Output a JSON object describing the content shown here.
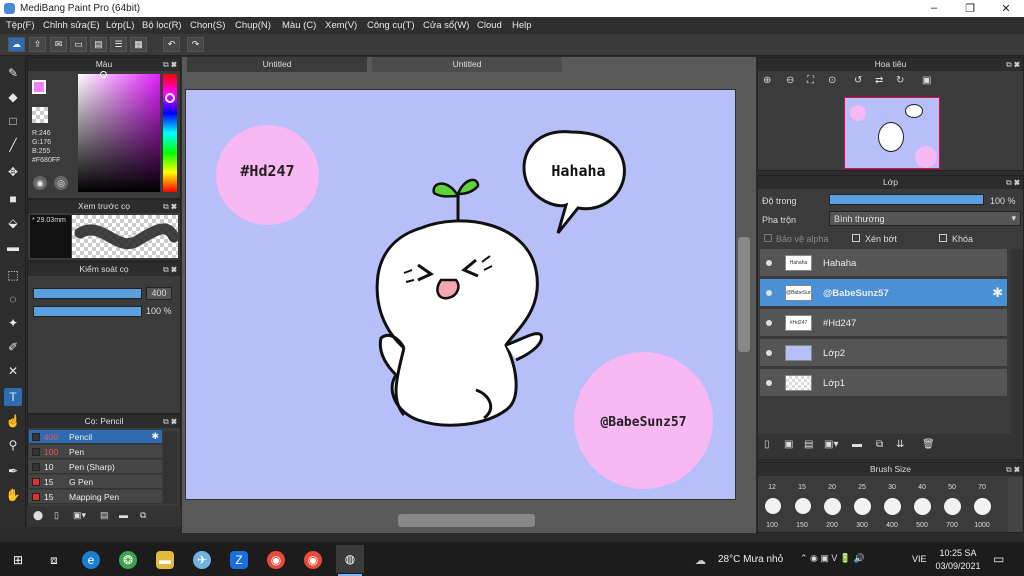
{
  "window": {
    "title": "MediBang Paint Pro (64bit)",
    "minimize": "–",
    "maximize": "❐",
    "close": "✕"
  },
  "menu": [
    "Tệp(F)",
    "Chỉnh sửa(E)",
    "Lớp(L)",
    "Bộ lọc(R)",
    "Chọn(S)",
    "Chụp(N)",
    "Màu (C)",
    "Xem(V)",
    "Công cụ(T)",
    "Cửa sổ(W)",
    "Cloud",
    "Help"
  ],
  "color_panel": {
    "title": "Màu",
    "rgb": [
      "R:246",
      "G:176",
      "B:255"
    ],
    "hex": "#F680FF",
    "current_color": "#F680FF"
  },
  "brush_preview": {
    "title": "Xem trước cọ",
    "size": "29.03mm"
  },
  "brush_control": {
    "title": "Kiểm soát cọ",
    "size_value": "400",
    "opacity_value": "100 %"
  },
  "brush_list": {
    "title": "Cọ: Pencil",
    "items": [
      {
        "size": "400",
        "name": "Pencil",
        "color": "#333333",
        "selected": true
      },
      {
        "size": "100",
        "name": "Pen",
        "color": "#333333",
        "selected": false
      },
      {
        "size": "10",
        "name": "Pen (Sharp)",
        "color": "#333333",
        "selected": false
      },
      {
        "size": "15",
        "name": "G Pen",
        "color": "#e03030",
        "selected": false
      },
      {
        "size": "15",
        "name": "Mapping Pen",
        "color": "#e03030",
        "selected": false
      }
    ]
  },
  "tabs": [
    "Untitled",
    "Untitled"
  ],
  "canvas": {
    "bubble": "Hahaha",
    "circle1": "#Hd247",
    "circle2": "@BabeSunz57",
    "bg": "#b7bff9",
    "circle_color": "#f7b8f4"
  },
  "navigator": {
    "title": "Hoa tiêu"
  },
  "layer_panel": {
    "title": "Lớp",
    "opacity_label": "Độ trong",
    "opacity_value": "100 %",
    "blend_label": "Pha trộn",
    "blend_value": "Bình thường",
    "protect_alpha": "Bảo vệ alpha",
    "clip": "Xén bớt",
    "lock": "Khóa",
    "layers": [
      {
        "name": "Hahaha",
        "thumb": "Hahaha",
        "selected": false
      },
      {
        "name": "@BabeSunz57",
        "thumb": "@BabeSunz57",
        "selected": true
      },
      {
        "name": "#Hd247",
        "thumb": "#Hd247",
        "selected": false
      },
      {
        "name": "Lớp2",
        "thumb": "",
        "selected": false
      },
      {
        "name": "Lớp1",
        "thumb": "",
        "selected": false
      }
    ]
  },
  "brush_size": {
    "title": "Brush Size",
    "row1": [
      "12",
      "15",
      "20",
      "25",
      "30",
      "40",
      "50",
      "70"
    ],
    "row2": [
      "100",
      "150",
      "200",
      "300",
      "400",
      "500",
      "700",
      "1000"
    ]
  },
  "taskbar": {
    "weather": "28°C Mưa nhỏ",
    "lang": "VIE",
    "time": "10:25 SA",
    "date": "03/09/2021"
  }
}
